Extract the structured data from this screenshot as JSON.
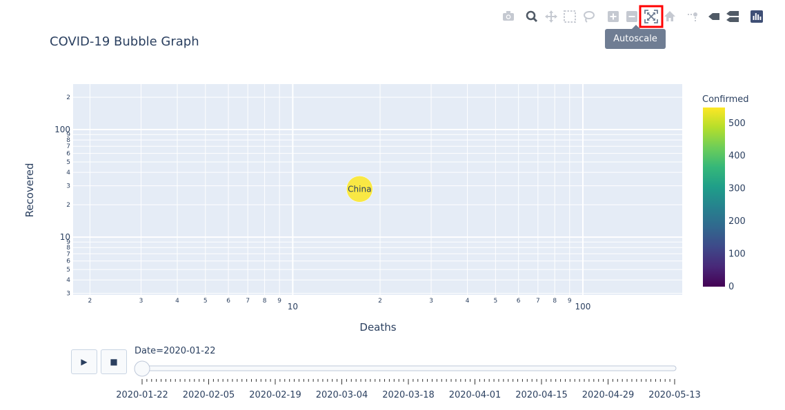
{
  "title": "COVID-19 Bubble Graph",
  "tooltip": "Autoscale",
  "modebar": [
    "camera-icon",
    "zoom-icon",
    "pan-icon",
    "box-select-icon",
    "lasso-select-icon",
    "zoom-in-icon",
    "zoom-out-icon",
    "autoscale-icon",
    "reset-axes-icon",
    "spike-lines-icon",
    "hover-closest-icon",
    "hover-compare-icon",
    "plotly-logo-icon"
  ],
  "slider": {
    "current_label": "Date=2020-01-22",
    "play_icon": "▶",
    "stop_icon": "■",
    "ticks": [
      "2020-01-22",
      "2020-02-05",
      "2020-02-19",
      "2020-03-04",
      "2020-03-18",
      "2020-04-01",
      "2020-04-15",
      "2020-04-29",
      "2020-05-13"
    ],
    "value": 0
  },
  "colorbar": {
    "title": "Confirmed",
    "ticks": [
      0,
      100,
      200,
      300,
      400,
      500
    ],
    "range": [
      0,
      548
    ],
    "colors": [
      "#440154",
      "#482878",
      "#3e4989",
      "#31688e",
      "#26828e",
      "#1f9e89",
      "#35b779",
      "#6ece58",
      "#b5de2b",
      "#fde725"
    ]
  },
  "chart_data": {
    "type": "scatter",
    "xlabel": "Deaths",
    "ylabel": "Recovered",
    "x_scale": "log",
    "y_scale": "log",
    "xlim": [
      1.75,
      220
    ],
    "ylim": [
      2.9,
      265
    ],
    "grid": true,
    "x_major_ticks": [
      {
        "v": 10,
        "label": "10"
      },
      {
        "v": 100,
        "label": "100"
      }
    ],
    "x_minor_ticks": [
      {
        "v": 2,
        "label": "2"
      },
      {
        "v": 3,
        "label": "3"
      },
      {
        "v": 4,
        "label": "4"
      },
      {
        "v": 5,
        "label": "5"
      },
      {
        "v": 6,
        "label": "6"
      },
      {
        "v": 7,
        "label": "7"
      },
      {
        "v": 8,
        "label": "8"
      },
      {
        "v": 9,
        "label": "9"
      },
      {
        "v": 20,
        "label": "2"
      },
      {
        "v": 30,
        "label": "3"
      },
      {
        "v": 40,
        "label": "4"
      },
      {
        "v": 50,
        "label": "5"
      },
      {
        "v": 60,
        "label": "6"
      },
      {
        "v": 70,
        "label": "7"
      },
      {
        "v": 80,
        "label": "8"
      },
      {
        "v": 90,
        "label": "9"
      }
    ],
    "y_major_ticks": [
      {
        "v": 10,
        "label": "10"
      },
      {
        "v": 100,
        "label": "100"
      }
    ],
    "y_minor_ticks": [
      {
        "v": 3,
        "label": "3"
      },
      {
        "v": 4,
        "label": "4"
      },
      {
        "v": 5,
        "label": "5"
      },
      {
        "v": 6,
        "label": "6"
      },
      {
        "v": 7,
        "label": "7"
      },
      {
        "v": 8,
        "label": "8"
      },
      {
        "v": 9,
        "label": "9"
      },
      {
        "v": 20,
        "label": "2"
      },
      {
        "v": 30,
        "label": "3"
      },
      {
        "v": 40,
        "label": "4"
      },
      {
        "v": 50,
        "label": "5"
      },
      {
        "v": 60,
        "label": "6"
      },
      {
        "v": 70,
        "label": "7"
      },
      {
        "v": 80,
        "label": "8"
      },
      {
        "v": 90,
        "label": "9"
      },
      {
        "v": 200,
        "label": "2"
      }
    ],
    "points": [
      {
        "label": "China",
        "deaths": 17,
        "recovered": 28,
        "confirmed": 548
      }
    ]
  }
}
